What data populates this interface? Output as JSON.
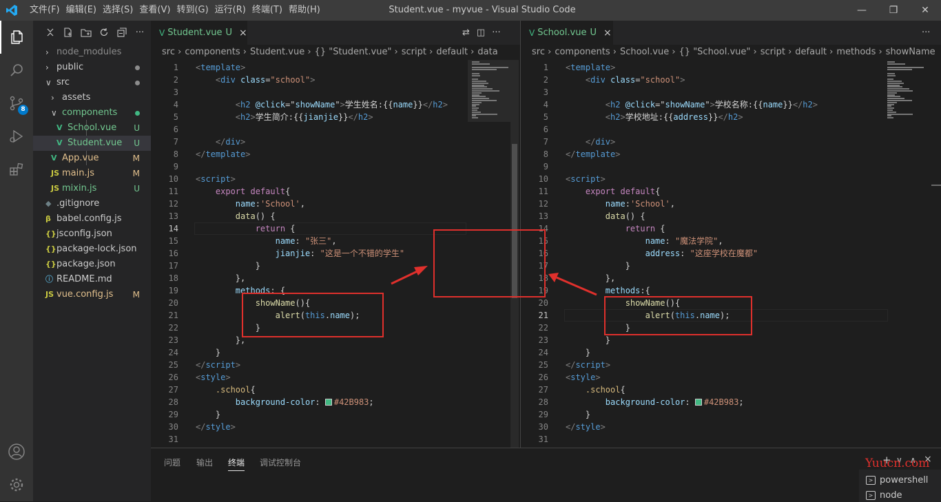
{
  "titlebar": {
    "menus": [
      "文件(F)",
      "编辑(E)",
      "选择(S)",
      "查看(V)",
      "转到(G)",
      "运行(R)",
      "终端(T)",
      "帮助(H)"
    ],
    "window_title": "Student.vue - myvue - Visual Studio Code"
  },
  "activity_bar": {
    "items": [
      "explorer-icon",
      "search-icon",
      "source-control-icon",
      "run-debug-icon",
      "extensions-icon"
    ],
    "scm_badge": "8",
    "bottom": [
      "account-icon",
      "settings-gear-icon"
    ]
  },
  "explorer": {
    "tree": [
      {
        "name": "node_modules",
        "kind": "folder",
        "open": false,
        "depth": 0,
        "color": "#8c8c8c"
      },
      {
        "name": "public",
        "kind": "folder",
        "open": false,
        "depth": 0,
        "color": "#cccccc",
        "dot": "#8c8c8c"
      },
      {
        "name": "src",
        "kind": "folder",
        "open": true,
        "depth": 0,
        "color": "#cccccc",
        "dot": "#8c8c8c"
      },
      {
        "name": "assets",
        "kind": "folder",
        "open": false,
        "depth": 1,
        "color": "#cccccc"
      },
      {
        "name": "components",
        "kind": "folder",
        "open": true,
        "depth": 1,
        "color": "#73c991",
        "dot": "#41b883"
      },
      {
        "name": "School.vue",
        "kind": "vue",
        "depth": 2,
        "color": "#73c991",
        "status": "U"
      },
      {
        "name": "Student.vue",
        "kind": "vue",
        "depth": 2,
        "color": "#73c991",
        "status": "U",
        "selected": true
      },
      {
        "name": "App.vue",
        "kind": "vue",
        "depth": 1,
        "color": "#e2c08d",
        "status": "M"
      },
      {
        "name": "main.js",
        "kind": "js",
        "depth": 1,
        "color": "#e2c08d",
        "status": "M"
      },
      {
        "name": "mixin.js",
        "kind": "js",
        "depth": 1,
        "color": "#73c991",
        "status": "U"
      },
      {
        "name": ".gitignore",
        "kind": "git",
        "depth": 0,
        "color": "#cccccc"
      },
      {
        "name": "babel.config.js",
        "kind": "babel",
        "depth": 0,
        "color": "#cccccc"
      },
      {
        "name": "jsconfig.json",
        "kind": "json",
        "depth": 0,
        "color": "#cccccc"
      },
      {
        "name": "package-lock.json",
        "kind": "json",
        "depth": 0,
        "color": "#cccccc"
      },
      {
        "name": "package.json",
        "kind": "json",
        "depth": 0,
        "color": "#cccccc"
      },
      {
        "name": "README.md",
        "kind": "info",
        "depth": 0,
        "color": "#cccccc"
      },
      {
        "name": "vue.config.js",
        "kind": "js",
        "depth": 0,
        "color": "#e2c08d",
        "status": "M"
      }
    ]
  },
  "icon_glyphs": {
    "vue": "V",
    "js": "JS",
    "json": "{}",
    "git": "◆",
    "babel": "β",
    "info": "ⓘ",
    "folder_open": "∨",
    "folder_closed": "›"
  },
  "editor_left": {
    "tab": {
      "vue_icon": "V",
      "name": "Student.vue",
      "status": "U",
      "close": "×"
    },
    "breadcrumb": [
      "src",
      "components",
      "Student.vue",
      "{} \"Student.vue\"",
      "script",
      "default",
      "data"
    ],
    "current_line": 14,
    "lines": [
      [
        [
          "tg",
          "<"
        ],
        [
          "tn2",
          "template"
        ],
        [
          "tg",
          ">"
        ]
      ],
      [
        [
          "",
          "    "
        ],
        [
          "tg",
          "<"
        ],
        [
          "tn2",
          "div"
        ],
        [
          "",
          " "
        ],
        [
          "at",
          "class"
        ],
        [
          "",
          "="
        ],
        [
          "sv",
          "\"school\""
        ],
        [
          "tg",
          ">"
        ]
      ],
      [],
      [
        [
          "",
          "        "
        ],
        [
          "tg",
          "<"
        ],
        [
          "tn2",
          "h2"
        ],
        [
          "",
          " "
        ],
        [
          "at",
          "@click"
        ],
        [
          "",
          "=\""
        ],
        [
          "at",
          "showName"
        ],
        [
          "",
          "\""
        ],
        [
          "tg",
          ">"
        ],
        [
          "",
          "学生姓名:{{"
        ],
        [
          "at",
          "name"
        ],
        [
          "",
          "}}"
        ],
        [
          "tg",
          "</"
        ],
        [
          "tn2",
          "h2"
        ],
        [
          "tg",
          ">"
        ]
      ],
      [
        [
          "",
          "        "
        ],
        [
          "tg",
          "<"
        ],
        [
          "tn2",
          "h2"
        ],
        [
          "tg",
          ">"
        ],
        [
          "",
          "学生简介:{{"
        ],
        [
          "at",
          "jianjie"
        ],
        [
          "",
          "}}"
        ],
        [
          "tg",
          "</"
        ],
        [
          "tn2",
          "h2"
        ],
        [
          "tg",
          ">"
        ]
      ],
      [],
      [
        [
          "",
          "    "
        ],
        [
          "tg",
          "</"
        ],
        [
          "tn2",
          "div"
        ],
        [
          "tg",
          ">"
        ]
      ],
      [
        [
          "tg",
          "</"
        ],
        [
          "tn2",
          "template"
        ],
        [
          "tg",
          ">"
        ]
      ],
      [],
      [
        [
          "tg",
          "<"
        ],
        [
          "tn2",
          "script"
        ],
        [
          "tg",
          ">"
        ]
      ],
      [
        [
          "",
          "    "
        ],
        [
          "kw",
          "export"
        ],
        [
          "",
          " "
        ],
        [
          "kw",
          "default"
        ],
        [
          "",
          "{"
        ]
      ],
      [
        [
          "",
          "        "
        ],
        [
          "pr",
          "name"
        ],
        [
          "",
          ":"
        ],
        [
          "sv",
          "'School'"
        ],
        [
          "",
          ","
        ]
      ],
      [
        [
          "",
          "        "
        ],
        [
          "fn",
          "data"
        ],
        [
          "",
          "() {"
        ]
      ],
      [
        [
          "",
          "            "
        ],
        [
          "kw",
          "return"
        ],
        [
          "",
          " {"
        ]
      ],
      [
        [
          "",
          "                "
        ],
        [
          "pr",
          "name"
        ],
        [
          "",
          ": "
        ],
        [
          "sv",
          "\"张三\""
        ],
        [
          "",
          ","
        ]
      ],
      [
        [
          "",
          "                "
        ],
        [
          "pr",
          "jianjie"
        ],
        [
          "",
          ": "
        ],
        [
          "sv",
          "\"这是一个不错的学生\""
        ]
      ],
      [
        [
          "",
          "            "
        ],
        [
          "",
          "}"
        ]
      ],
      [
        [
          "",
          "        "
        ],
        [
          "",
          "},"
        ]
      ],
      [
        [
          "",
          "        "
        ],
        [
          "pr",
          "methods"
        ],
        [
          "",
          ": {"
        ]
      ],
      [
        [
          "",
          "            "
        ],
        [
          "fn",
          "showName"
        ],
        [
          "",
          "(){"
        ]
      ],
      [
        [
          "",
          "                "
        ],
        [
          "fn",
          "alert"
        ],
        [
          "",
          "("
        ],
        [
          "bl",
          "this"
        ],
        [
          "",
          "."
        ],
        [
          "pr",
          "name"
        ],
        [
          "",
          ");"
        ]
      ],
      [
        [
          "",
          "            "
        ],
        [
          "",
          "}"
        ]
      ],
      [
        [
          "",
          "        "
        ],
        [
          "",
          "},"
        ]
      ],
      [
        [
          "",
          "    "
        ],
        [
          "",
          "}"
        ]
      ],
      [
        [
          "tg",
          "</"
        ],
        [
          "tn2",
          "script"
        ],
        [
          "tg",
          ">"
        ]
      ],
      [
        [
          "tg",
          "<"
        ],
        [
          "tn2",
          "style"
        ],
        [
          "tg",
          ">"
        ]
      ],
      [
        [
          "",
          "    "
        ],
        [
          "sel2",
          ".school"
        ],
        [
          "",
          "{"
        ]
      ],
      [
        [
          "",
          "        "
        ],
        [
          "pr",
          "background-color"
        ],
        [
          "",
          ": "
        ],
        [
          "swatch",
          ""
        ],
        [
          "sv",
          "#42B983"
        ],
        [
          "",
          ";"
        ]
      ],
      [
        [
          "",
          "    "
        ],
        [
          "",
          "}"
        ]
      ],
      [
        [
          "tg",
          "</"
        ],
        [
          "tn2",
          "style"
        ],
        [
          "tg",
          ">"
        ]
      ],
      []
    ]
  },
  "editor_right": {
    "tab": {
      "vue_icon": "V",
      "name": "School.vue",
      "status": "U",
      "close": "×"
    },
    "breadcrumb": [
      "src",
      "components",
      "School.vue",
      "{} \"School.vue\"",
      "script",
      "default",
      "methods",
      "showName"
    ],
    "current_line": 21,
    "lines": [
      [
        [
          "tg",
          "<"
        ],
        [
          "tn2",
          "template"
        ],
        [
          "tg",
          ">"
        ]
      ],
      [
        [
          "",
          "    "
        ],
        [
          "tg",
          "<"
        ],
        [
          "tn2",
          "div"
        ],
        [
          "",
          " "
        ],
        [
          "at",
          "class"
        ],
        [
          "",
          "="
        ],
        [
          "sv",
          "\"school\""
        ],
        [
          "tg",
          ">"
        ]
      ],
      [],
      [
        [
          "",
          "        "
        ],
        [
          "tg",
          "<"
        ],
        [
          "tn2",
          "h2"
        ],
        [
          "",
          " "
        ],
        [
          "at",
          "@click"
        ],
        [
          "",
          "=\""
        ],
        [
          "at",
          "showName"
        ],
        [
          "",
          "\""
        ],
        [
          "tg",
          ">"
        ],
        [
          "",
          "学校名称:{{"
        ],
        [
          "at",
          "name"
        ],
        [
          "",
          "}}"
        ],
        [
          "tg",
          "</"
        ],
        [
          "tn2",
          "h2"
        ],
        [
          "tg",
          ">"
        ]
      ],
      [
        [
          "",
          "        "
        ],
        [
          "tg",
          "<"
        ],
        [
          "tn2",
          "h2"
        ],
        [
          "tg",
          ">"
        ],
        [
          "",
          "学校地址:{{"
        ],
        [
          "at",
          "address"
        ],
        [
          "",
          "}}"
        ],
        [
          "tg",
          "</"
        ],
        [
          "tn2",
          "h2"
        ],
        [
          "tg",
          ">"
        ]
      ],
      [],
      [
        [
          "",
          "    "
        ],
        [
          "tg",
          "</"
        ],
        [
          "tn2",
          "div"
        ],
        [
          "tg",
          ">"
        ]
      ],
      [
        [
          "tg",
          "</"
        ],
        [
          "tn2",
          "template"
        ],
        [
          "tg",
          ">"
        ]
      ],
      [],
      [
        [
          "tg",
          "<"
        ],
        [
          "tn2",
          "script"
        ],
        [
          "tg",
          ">"
        ]
      ],
      [
        [
          "",
          "    "
        ],
        [
          "kw",
          "export"
        ],
        [
          "",
          " "
        ],
        [
          "kw",
          "default"
        ],
        [
          "",
          "{"
        ]
      ],
      [
        [
          "",
          "        "
        ],
        [
          "pr",
          "name"
        ],
        [
          "",
          ":"
        ],
        [
          "sv",
          "'School'"
        ],
        [
          "",
          ","
        ]
      ],
      [
        [
          "",
          "        "
        ],
        [
          "fn",
          "data"
        ],
        [
          "",
          "() {"
        ]
      ],
      [
        [
          "",
          "            "
        ],
        [
          "kw",
          "return"
        ],
        [
          "",
          " {"
        ]
      ],
      [
        [
          "",
          "                "
        ],
        [
          "pr",
          "name"
        ],
        [
          "",
          ": "
        ],
        [
          "sv",
          "\"魔法学院\""
        ],
        [
          "",
          ","
        ]
      ],
      [
        [
          "",
          "                "
        ],
        [
          "pr",
          "address"
        ],
        [
          "",
          ": "
        ],
        [
          "sv",
          "\"这座学校在魔都\""
        ]
      ],
      [
        [
          "",
          "            "
        ],
        [
          "",
          "}"
        ]
      ],
      [
        [
          "",
          "        "
        ],
        [
          "",
          "},"
        ]
      ],
      [
        [
          "",
          "        "
        ],
        [
          "pr",
          "methods"
        ],
        [
          "",
          ":{"
        ]
      ],
      [
        [
          "",
          "            "
        ],
        [
          "fn",
          "showName"
        ],
        [
          "",
          "(){"
        ]
      ],
      [
        [
          "",
          "                "
        ],
        [
          "fn",
          "alert"
        ],
        [
          "",
          "("
        ],
        [
          "bl",
          "this"
        ],
        [
          "",
          "."
        ],
        [
          "pr",
          "name"
        ],
        [
          "",
          ");"
        ]
      ],
      [
        [
          "",
          "            "
        ],
        [
          "",
          "}"
        ]
      ],
      [
        [
          "",
          "        "
        ],
        [
          "",
          "}"
        ]
      ],
      [
        [
          "",
          "    "
        ],
        [
          "",
          "}"
        ]
      ],
      [
        [
          "tg",
          "</"
        ],
        [
          "tn2",
          "script"
        ],
        [
          "tg",
          ">"
        ]
      ],
      [
        [
          "tg",
          "<"
        ],
        [
          "tn2",
          "style"
        ],
        [
          "tg",
          ">"
        ]
      ],
      [
        [
          "",
          "    "
        ],
        [
          "sel2",
          ".school"
        ],
        [
          "",
          "{"
        ]
      ],
      [
        [
          "",
          "        "
        ],
        [
          "pr",
          "background-color"
        ],
        [
          "",
          ": "
        ],
        [
          "swatch",
          ""
        ],
        [
          "sv",
          "#42B983"
        ],
        [
          "",
          ";"
        ]
      ],
      [
        [
          "",
          "    "
        ],
        [
          "",
          "}"
        ]
      ],
      [
        [
          "tg",
          "</"
        ],
        [
          "tn2",
          "style"
        ],
        [
          "tg",
          ">"
        ]
      ],
      []
    ]
  },
  "panel": {
    "tabs": [
      "问题",
      "输出",
      "终端",
      "调试控制台"
    ],
    "active_tab": "终端",
    "terminals": [
      "powershell",
      "node"
    ],
    "actions": [
      "+",
      "∨",
      "∧",
      "×"
    ]
  },
  "watermark": "Yuucn.com",
  "colors": {
    "accent": "#007acc",
    "annotation": "#e0302c",
    "vue_green": "#41b883",
    "untracked": "#73c991",
    "modified": "#e2c08d"
  }
}
